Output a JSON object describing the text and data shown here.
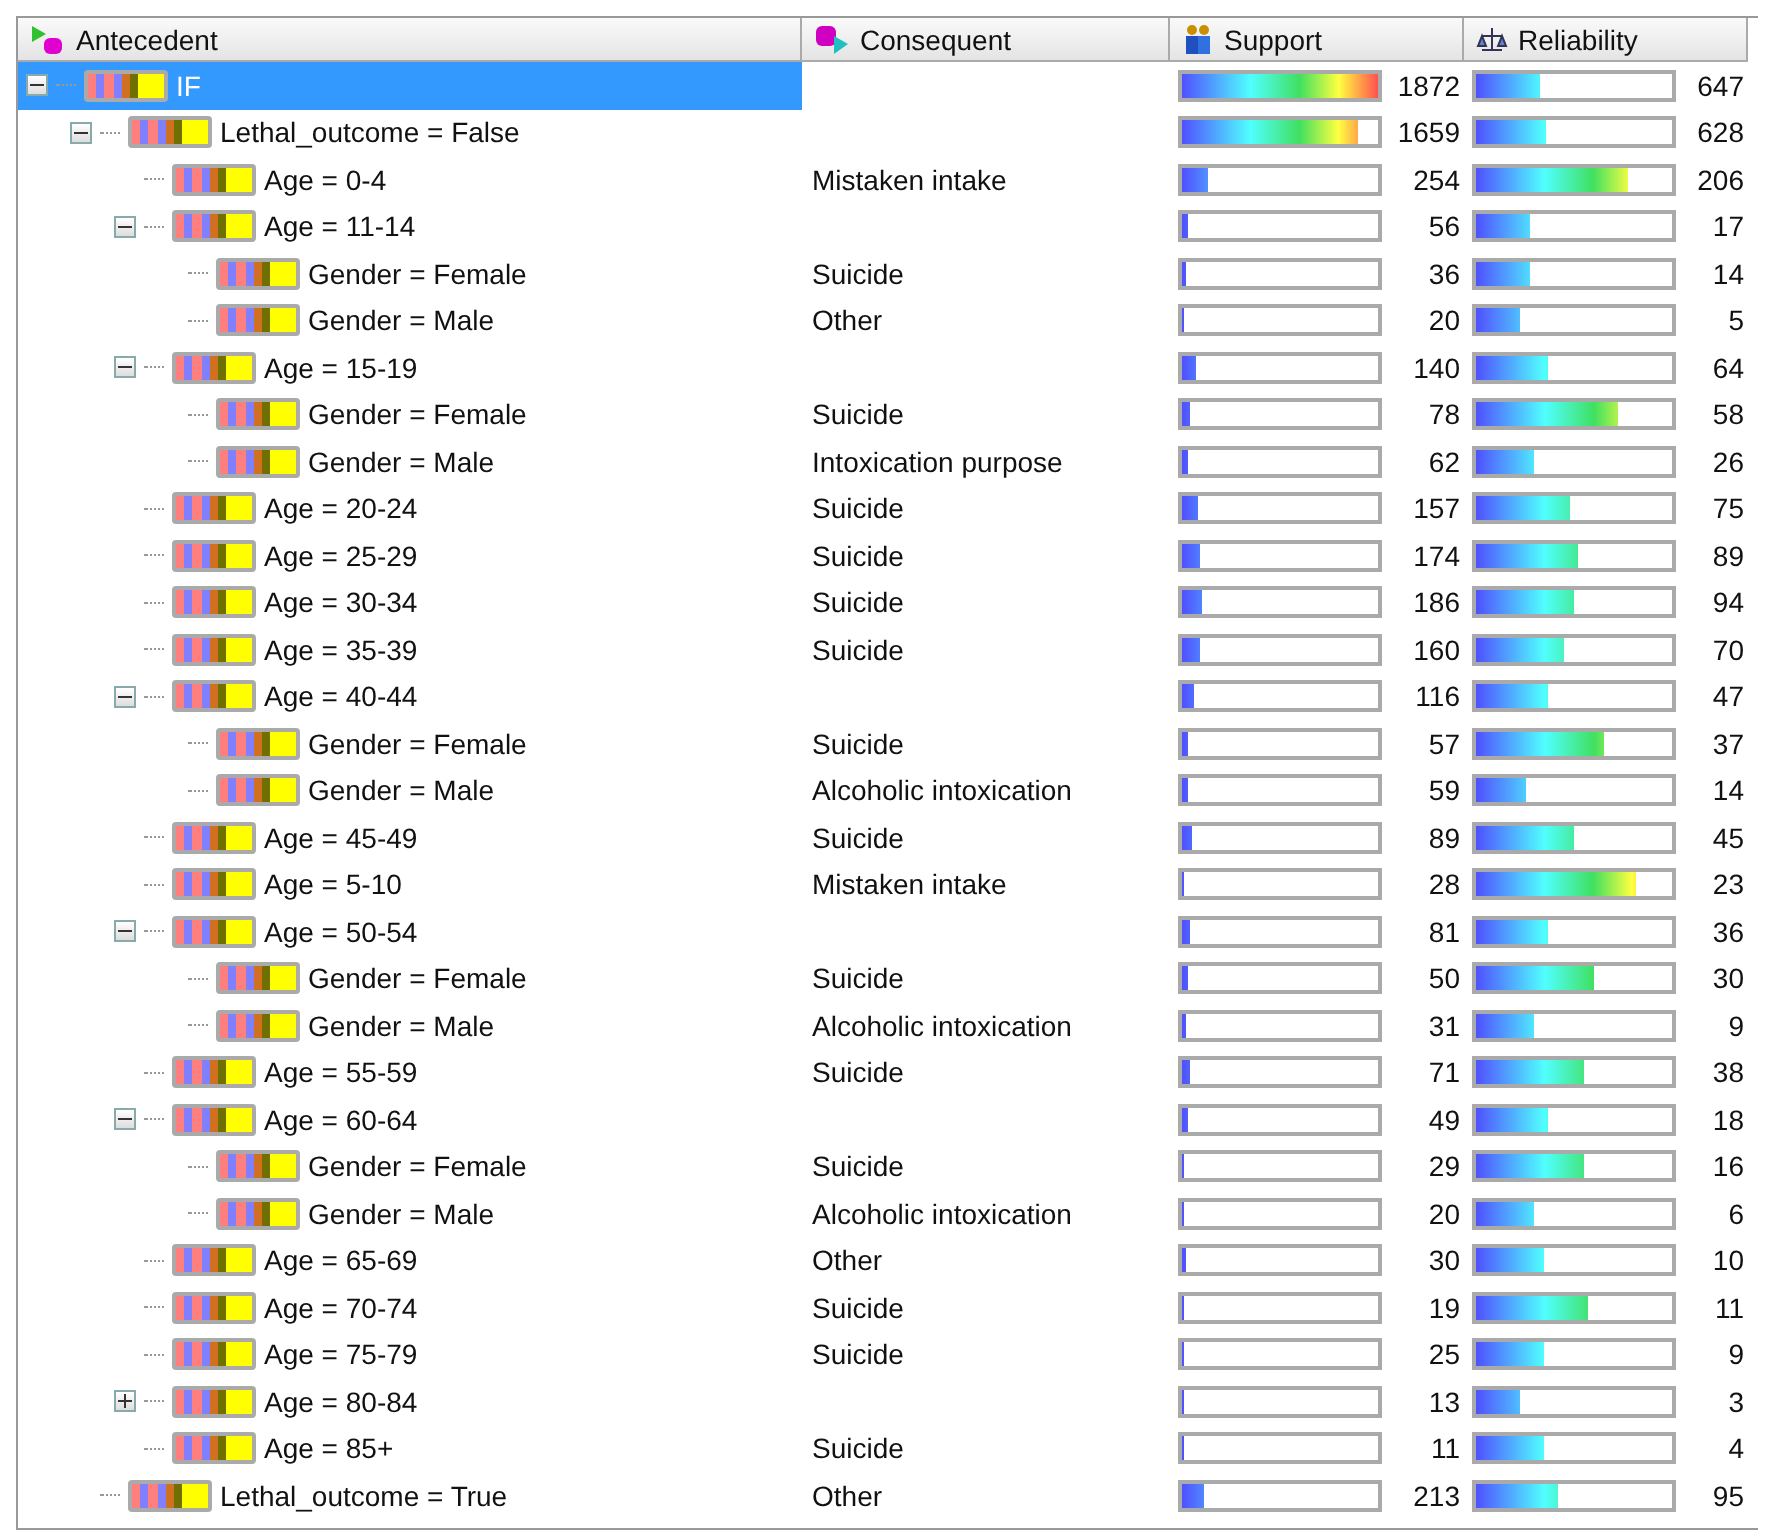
{
  "columns": [
    "Antecedent",
    "Consequent",
    "Support",
    "Reliability"
  ],
  "rules": [
    {
      "label": "IF",
      "selected": true,
      "expanded": true,
      "support": {
        "value": "1872",
        "level": 1.0
      },
      "reliability": {
        "value": "647",
        "level": 0.33
      },
      "children": [
        {
          "label": "Lethal_outcome = False",
          "selected": false,
          "expanded": true,
          "support": {
            "value": "1659",
            "level": 0.9
          },
          "reliability": {
            "value": "628",
            "level": 0.36
          },
          "children": [
            {
              "label": "Age = 0-4",
              "consequent": "Mistaken intake",
              "selected": false,
              "support": {
                "value": "254",
                "level": 0.13
              },
              "reliability": {
                "value": "206",
                "level": 0.78
              }
            },
            {
              "label": "Age = 11-14",
              "selected": false,
              "expanded": true,
              "support": {
                "value": "56",
                "level": 0.03
              },
              "reliability": {
                "value": "17",
                "level": 0.28
              },
              "children": [
                {
                  "label": "Gender = Female",
                  "consequent": "Suicide",
                  "selected": false,
                  "support": {
                    "value": "36",
                    "level": 0.02
                  },
                  "reliability": {
                    "value": "14",
                    "level": 0.28
                  }
                },
                {
                  "label": "Gender = Male",
                  "consequent": "Other",
                  "selected": false,
                  "support": {
                    "value": "20",
                    "level": 0.01
                  },
                  "reliability": {
                    "value": "5",
                    "level": 0.22
                  }
                }
              ]
            },
            {
              "label": "Age = 15-19",
              "selected": false,
              "expanded": true,
              "support": {
                "value": "140",
                "level": 0.07
              },
              "reliability": {
                "value": "64",
                "level": 0.37
              },
              "children": [
                {
                  "label": "Gender = Female",
                  "consequent": "Suicide",
                  "selected": false,
                  "support": {
                    "value": "78",
                    "level": 0.04
                  },
                  "reliability": {
                    "value": "58",
                    "level": 0.72
                  }
                },
                {
                  "label": "Gender = Male",
                  "consequent": "Intoxication purpose",
                  "selected": false,
                  "support": {
                    "value": "62",
                    "level": 0.03
                  },
                  "reliability": {
                    "value": "26",
                    "level": 0.3
                  }
                }
              ]
            },
            {
              "label": "Age = 20-24",
              "consequent": "Suicide",
              "selected": false,
              "support": {
                "value": "157",
                "level": 0.08
              },
              "reliability": {
                "value": "75",
                "level": 0.48
              }
            },
            {
              "label": "Age = 25-29",
              "consequent": "Suicide",
              "selected": false,
              "support": {
                "value": "174",
                "level": 0.09
              },
              "reliability": {
                "value": "89",
                "level": 0.52
              }
            },
            {
              "label": "Age = 30-34",
              "consequent": "Suicide",
              "selected": false,
              "support": {
                "value": "186",
                "level": 0.1
              },
              "reliability": {
                "value": "94",
                "level": 0.5
              }
            },
            {
              "label": "Age = 35-39",
              "consequent": "Suicide",
              "selected": false,
              "support": {
                "value": "160",
                "level": 0.09
              },
              "reliability": {
                "value": "70",
                "level": 0.45
              }
            },
            {
              "label": "Age = 40-44",
              "selected": false,
              "expanded": true,
              "support": {
                "value": "116",
                "level": 0.06
              },
              "reliability": {
                "value": "47",
                "level": 0.37
              },
              "children": [
                {
                  "label": "Gender = Female",
                  "consequent": "Suicide",
                  "selected": false,
                  "support": {
                    "value": "57",
                    "level": 0.03
                  },
                  "reliability": {
                    "value": "37",
                    "level": 0.65
                  }
                },
                {
                  "label": "Gender = Male",
                  "consequent": "Alcoholic intoxication",
                  "selected": false,
                  "support": {
                    "value": "59",
                    "level": 0.03
                  },
                  "reliability": {
                    "value": "14",
                    "level": 0.25
                  }
                }
              ]
            },
            {
              "label": "Age = 45-49",
              "consequent": "Suicide",
              "selected": false,
              "support": {
                "value": "89",
                "level": 0.05
              },
              "reliability": {
                "value": "45",
                "level": 0.5
              }
            },
            {
              "label": "Age = 5-10",
              "consequent": "Mistaken intake",
              "selected": false,
              "support": {
                "value": "28",
                "level": 0.015
              },
              "reliability": {
                "value": "23",
                "level": 0.82
              }
            },
            {
              "label": "Age = 50-54",
              "selected": false,
              "expanded": true,
              "support": {
                "value": "81",
                "level": 0.04
              },
              "reliability": {
                "value": "36",
                "level": 0.37
              },
              "children": [
                {
                  "label": "Gender = Female",
                  "consequent": "Suicide",
                  "selected": false,
                  "support": {
                    "value": "50",
                    "level": 0.03
                  },
                  "reliability": {
                    "value": "30",
                    "level": 0.6
                  }
                },
                {
                  "label": "Gender = Male",
                  "consequent": "Alcoholic intoxication",
                  "selected": false,
                  "support": {
                    "value": "31",
                    "level": 0.02
                  },
                  "reliability": {
                    "value": "9",
                    "level": 0.3
                  }
                }
              ]
            },
            {
              "label": "Age = 55-59",
              "consequent": "Suicide",
              "selected": false,
              "support": {
                "value": "71",
                "level": 0.04
              },
              "reliability": {
                "value": "38",
                "level": 0.55
              }
            },
            {
              "label": "Age = 60-64",
              "selected": false,
              "expanded": true,
              "support": {
                "value": "49",
                "level": 0.03
              },
              "reliability": {
                "value": "18",
                "level": 0.37
              },
              "children": [
                {
                  "label": "Gender = Female",
                  "consequent": "Suicide",
                  "selected": false,
                  "support": {
                    "value": "29",
                    "level": 0.015
                  },
                  "reliability": {
                    "value": "16",
                    "level": 0.55
                  }
                },
                {
                  "label": "Gender = Male",
                  "consequent": "Alcoholic intoxication",
                  "selected": false,
                  "support": {
                    "value": "20",
                    "level": 0.01
                  },
                  "reliability": {
                    "value": "6",
                    "level": 0.3
                  }
                }
              ]
            },
            {
              "label": "Age = 65-69",
              "consequent": "Other",
              "selected": false,
              "support": {
                "value": "30",
                "level": 0.016
              },
              "reliability": {
                "value": "10",
                "level": 0.35
              }
            },
            {
              "label": "Age = 70-74",
              "consequent": "Suicide",
              "selected": false,
              "support": {
                "value": "19",
                "level": 0.01
              },
              "reliability": {
                "value": "11",
                "level": 0.57
              }
            },
            {
              "label": "Age = 75-79",
              "consequent": "Suicide",
              "selected": false,
              "support": {
                "value": "25",
                "level": 0.013
              },
              "reliability": {
                "value": "9",
                "level": 0.35
              }
            },
            {
              "label": "Age = 80-84",
              "selected": false,
              "expanded": false,
              "support": {
                "value": "13",
                "level": 0.007
              },
              "reliability": {
                "value": "3",
                "level": 0.22
              }
            },
            {
              "label": "Age = 85+",
              "consequent": "Suicide",
              "selected": false,
              "support": {
                "value": "11",
                "level": 0.005
              },
              "reliability": {
                "value": "4",
                "level": 0.35
              }
            }
          ]
        },
        {
          "label": "Lethal_outcome = True",
          "consequent": "Other",
          "selected": false,
          "support": {
            "value": "213",
            "level": 0.11
          },
          "reliability": {
            "value": "95",
            "level": 0.42
          }
        }
      ]
    }
  ]
}
